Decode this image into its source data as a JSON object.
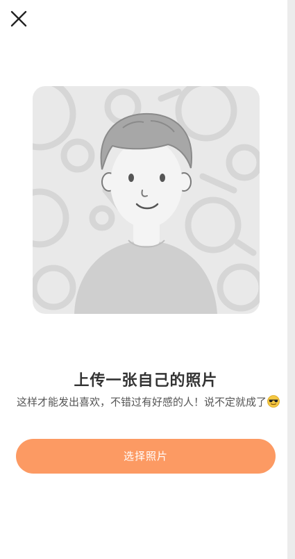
{
  "header": {
    "close_icon": "close-icon"
  },
  "illustration": {
    "icon": "person-avatar-illustration"
  },
  "content": {
    "title": "上传一张自己的照片",
    "subtitle": "这样才能发出喜欢，不错过有好感的人！说不定就成了",
    "emoji_icon": "sunglasses-emoji-icon"
  },
  "actions": {
    "choose_photo_label": "选择照片"
  },
  "colors": {
    "accent": "#fc9a63",
    "title": "#333333",
    "subtitle": "#555555",
    "illustration_bg": "#e9e9e9"
  }
}
